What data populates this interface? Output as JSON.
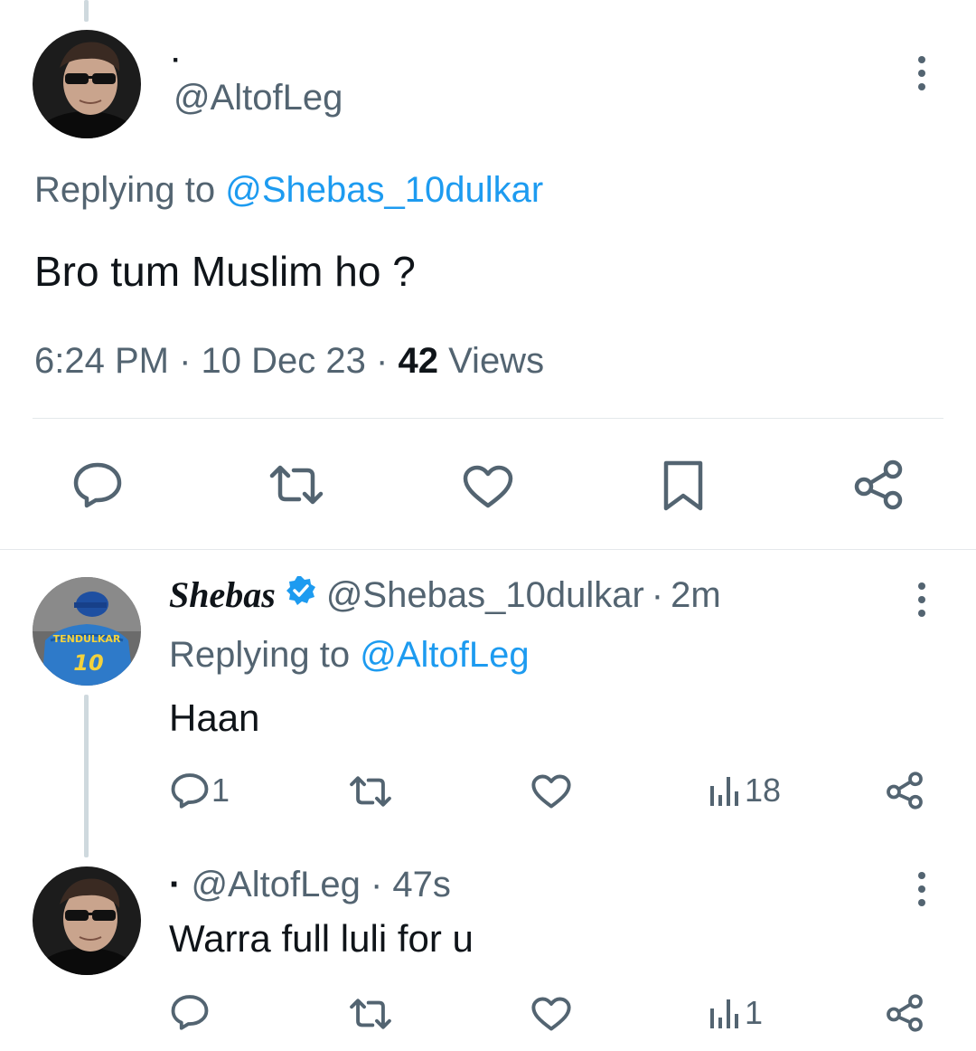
{
  "main_tweet": {
    "display_name": "·",
    "handle": "@AltofLeg",
    "replying_prefix": "Replying to",
    "replying_handle": "@Shebas_10dulkar",
    "text": "Bro tum Muslim ho ?",
    "time": "6:24 PM",
    "sep1": "·",
    "date": "10 Dec 23",
    "sep2": "·",
    "views_count": "42",
    "views_label": "Views"
  },
  "main_actions": [
    "reply-icon",
    "retweet-icon",
    "like-icon",
    "bookmark-icon",
    "share-icon"
  ],
  "reply1": {
    "display_name": "Shebas",
    "handle": "@Shebas_10dulkar",
    "sep": "·",
    "time": "2m",
    "replying_prefix": "Replying to",
    "replying_handle": "@AltofLeg",
    "text": "Haan",
    "reply_count": "1",
    "views_count": "18",
    "avatar_jersey_name": "TENDULKAR",
    "avatar_jersey_number": "10"
  },
  "reply2": {
    "display_name": "·",
    "handle": "@AltofLeg",
    "sep": "·",
    "time": "47s",
    "text": "Warra full luli for u",
    "views_count": "1"
  },
  "colors": {
    "text": "#0f1419",
    "secondary": "#536471",
    "link": "#1d9bf0",
    "verified": "#1d9bf0",
    "divider": "#e4e8eb",
    "thread_line": "#cfd9de"
  }
}
